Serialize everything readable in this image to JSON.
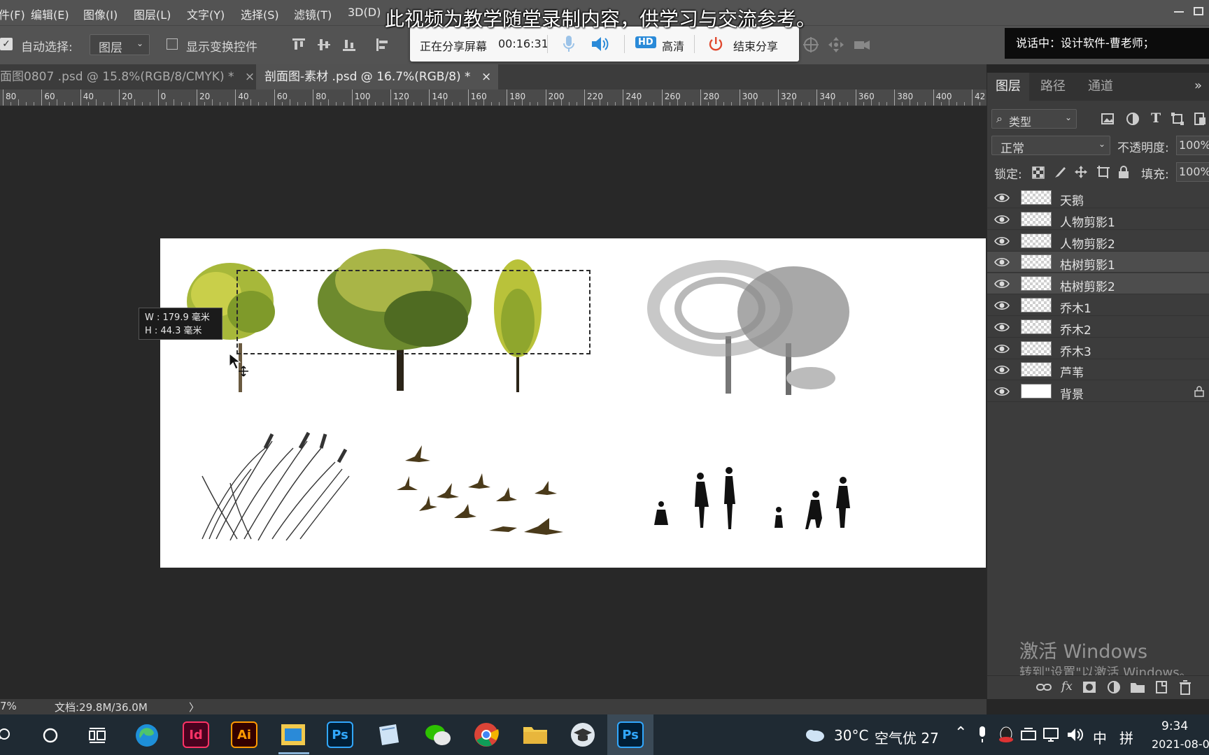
{
  "menu": {
    "items": [
      "件(F)",
      "编辑(E)",
      "图像(I)",
      "图层(L)",
      "文字(Y)",
      "选择(S)",
      "滤镜(T)",
      "3D(D)"
    ]
  },
  "caption": "此视频为教学随堂录制内容，供学习与交流参考。",
  "share_bar": {
    "status": "正在分享屏幕",
    "timer": "00:16:31",
    "hd_badge": "HD",
    "hd_label": "高清",
    "end_label": "结束分享"
  },
  "speaking": "说话中：设计软件-曹老师；",
  "options": {
    "auto_select_label": "自动选择:",
    "auto_select_value": "图层",
    "show_transform_label": "显示变换控件"
  },
  "tabs": [
    {
      "label": "面图0807 .psd @ 15.8%(RGB/8/CMYK) *",
      "close": "×"
    },
    {
      "label": "剖面图-素材 .psd @ 16.7%(RGB/8) *",
      "close": "×"
    }
  ],
  "ruler": [
    "80",
    "60",
    "40",
    "20",
    "0",
    "20",
    "40",
    "60",
    "80",
    "100",
    "120",
    "140",
    "160",
    "180",
    "200",
    "220",
    "240",
    "260",
    "280",
    "300",
    "320",
    "340",
    "360",
    "380",
    "400",
    "42"
  ],
  "size_tip": {
    "w_label": "W :",
    "w_value": "179.9 毫米",
    "h_label": "H :",
    "h_value": "44.3 毫米"
  },
  "status": {
    "zoom": "7%",
    "doc": "文档:29.8M/36.0M",
    "arrow": "〉"
  },
  "panel": {
    "tabs": [
      "图层",
      "路径",
      "通道"
    ],
    "more": "»",
    "filter_label": "类型",
    "blend_mode": "正常",
    "opacity_label": "不透明度:",
    "opacity_value": "100%",
    "lock_label": "锁定:",
    "fill_label": "填充:",
    "fill_value": "100%",
    "layers": [
      {
        "name": "天鹅",
        "selected": false
      },
      {
        "name": "人物剪影1",
        "selected": false
      },
      {
        "name": "人物剪影2",
        "selected": false
      },
      {
        "name": "枯树剪影1",
        "selected": true
      },
      {
        "name": "枯树剪影2",
        "selected": true
      },
      {
        "name": "乔木1",
        "selected": false
      },
      {
        "name": "乔木2",
        "selected": false
      },
      {
        "name": "乔木3",
        "selected": false
      },
      {
        "name": "芦苇",
        "selected": false
      },
      {
        "name": "背景",
        "selected": false,
        "locked": true
      }
    ],
    "footer_fx": "fx"
  },
  "watermark": {
    "title": "激活 Windows",
    "subtitle": "转到\"设置\"以激活 Windows。"
  },
  "taskbar": {
    "apps": [
      {
        "label": "Id",
        "color": "#49021f",
        "fg": "#ff3366"
      },
      {
        "label": "Ai",
        "color": "#330000",
        "fg": "#ff9a00"
      },
      {
        "label": "Ps",
        "color": "#001e36",
        "fg": "#31a8ff"
      },
      {
        "label": "Ps",
        "color": "#001e36",
        "fg": "#31a8ff"
      }
    ],
    "weather": "30°C",
    "air": "空气优 27",
    "ime": "中",
    "ime2": "拼",
    "time": "9:34",
    "date": "2021-08-0"
  }
}
